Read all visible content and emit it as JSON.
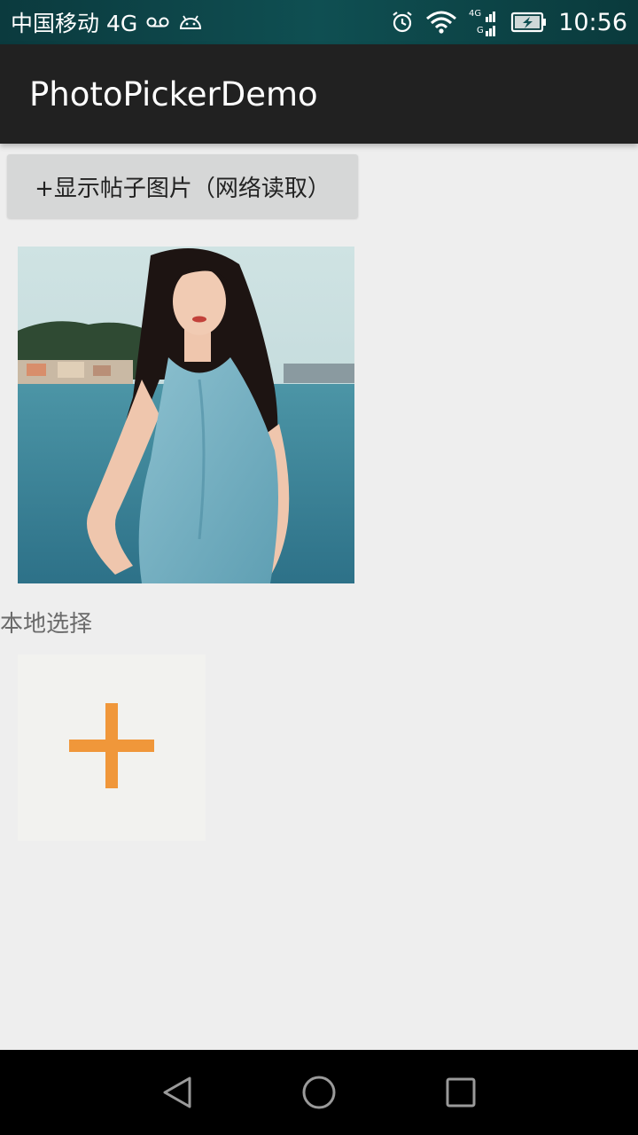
{
  "status_bar": {
    "carrier": "中国移动 4G",
    "time": "10:56",
    "icons": [
      "voicemail-icon",
      "android-debug-icon",
      "alarm-icon",
      "wifi-icon",
      "signal-icon",
      "battery-icon"
    ],
    "signal_labels": [
      "4G",
      "G"
    ]
  },
  "app_bar": {
    "title": "PhotoPickerDemo"
  },
  "content": {
    "network_button_label": "+显示帖子图片（网络读取）",
    "local_section_label": "本地选择",
    "add_icon": "plus-icon",
    "add_icon_color": "#f0973a"
  },
  "nav_bar": {
    "icons": [
      "back-icon",
      "home-icon",
      "recents-icon"
    ]
  }
}
